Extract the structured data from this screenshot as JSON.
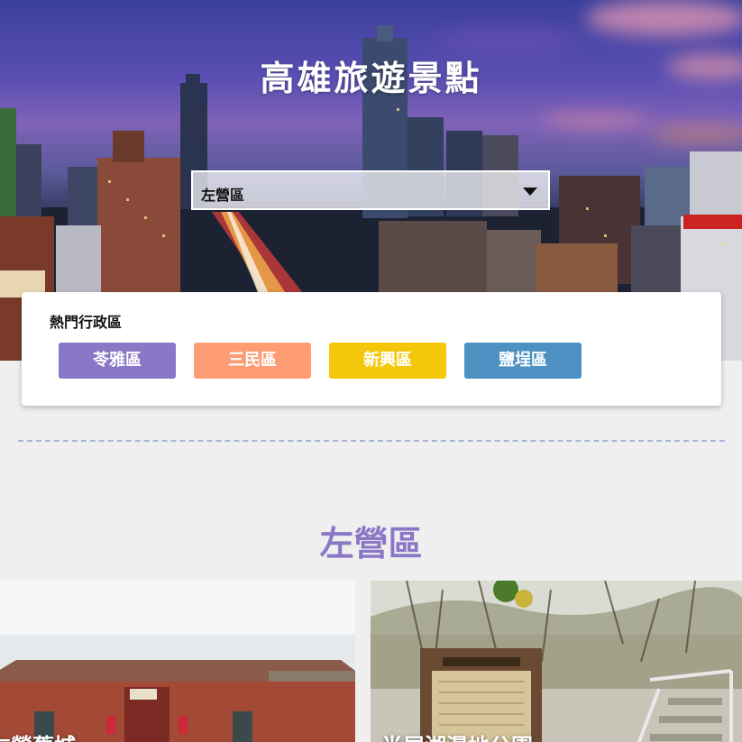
{
  "page": {
    "title": "高雄旅遊景點"
  },
  "district_select": {
    "selected": "左營區"
  },
  "popular": {
    "title": "熱門行政區",
    "districts": [
      {
        "label": "苓雅區",
        "color": "#8a78c6"
      },
      {
        "label": "三民區",
        "color": "#fe9c74"
      },
      {
        "label": "新興區",
        "color": "#f5c70b"
      },
      {
        "label": "鹽埕區",
        "color": "#4c91c2"
      }
    ]
  },
  "section": {
    "title": "左營區",
    "spots": [
      {
        "name": "左營舊城"
      },
      {
        "name": "半屏湖濕地公園"
      }
    ]
  },
  "colors": {
    "accent": "#8a78c6",
    "divider": "#a9b6da",
    "background": "#efefef"
  }
}
